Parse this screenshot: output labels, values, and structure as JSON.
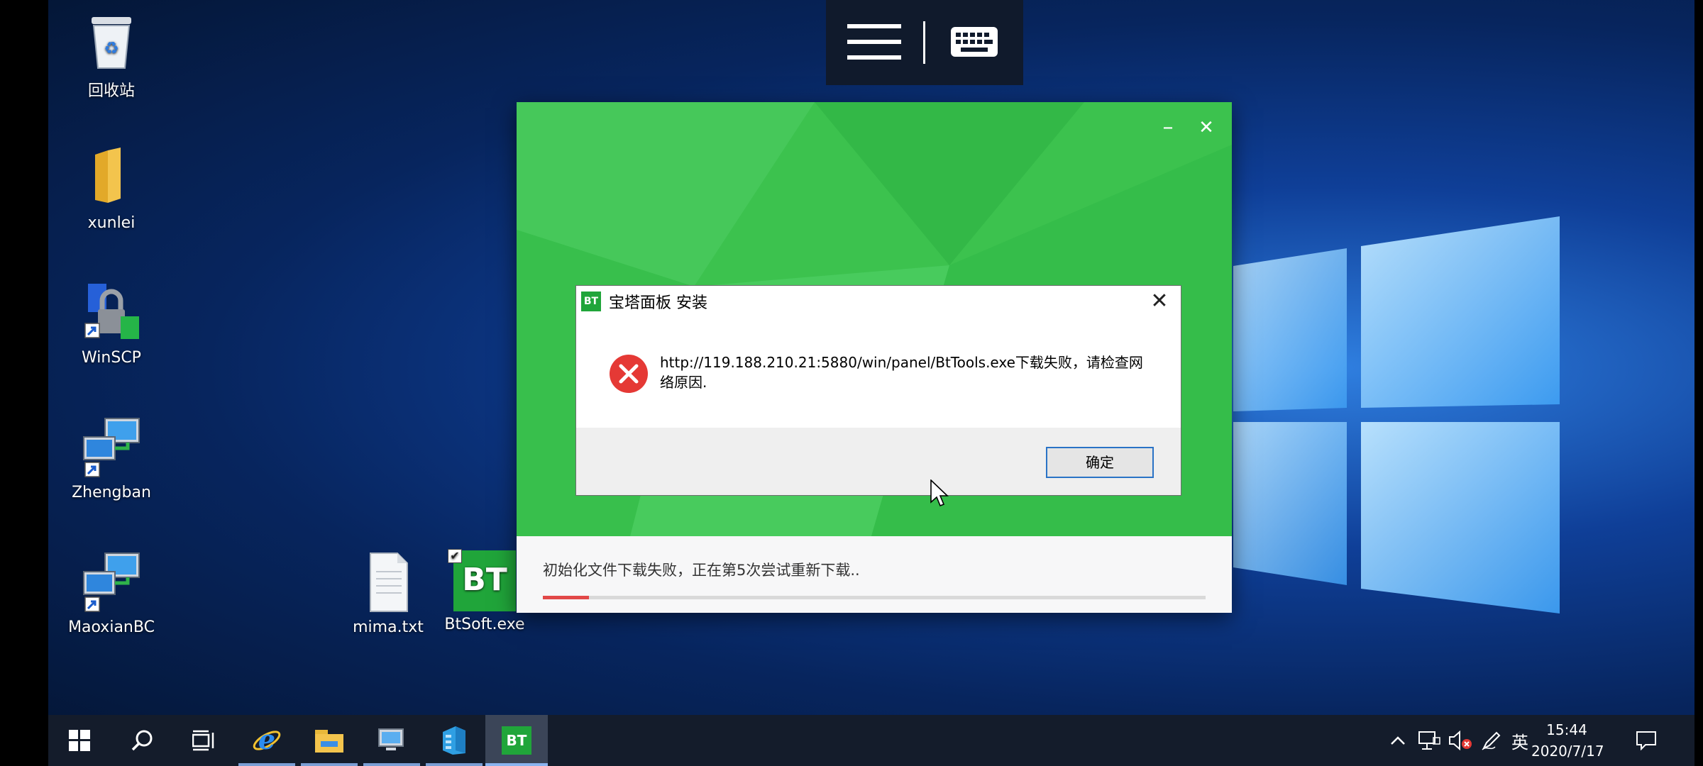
{
  "desktop": {
    "icons": [
      {
        "label": "回收站"
      },
      {
        "label": "xunlei"
      },
      {
        "label": "WinSCP"
      },
      {
        "label": "Zhengban"
      },
      {
        "label": "MaoxianBC"
      },
      {
        "label": "mima.txt"
      },
      {
        "label": "BtSoft.exe"
      }
    ],
    "bt_badge": "BT"
  },
  "installer": {
    "progress_text": "初始化文件下载失败，正在第5次尝试重新下载..",
    "progress_fraction": 0.07,
    "minimize_glyph": "–",
    "close_glyph": "✕"
  },
  "dialog": {
    "title": "宝塔面板 安装",
    "logo_text": "BT",
    "message": "http://119.188.210.21:5880/win/panel/BtTools.exe下载失败，请检查网络原因.",
    "ok_label": "确定",
    "close_glyph": "✕"
  },
  "taskbar": {
    "active_app_label": "BT",
    "clock_time": "15:44",
    "clock_date": "2020/7/17",
    "ime_label": "英"
  },
  "colors": {
    "installer_green": "#3cc24e",
    "progress_fill": "#e24848",
    "error_red": "#e53935",
    "button_border": "#2a73c6"
  }
}
